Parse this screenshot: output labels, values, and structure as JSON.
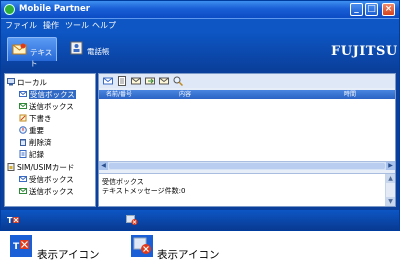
{
  "window": {
    "title": "Mobile Partner",
    "buttons": {
      "minimize": "_",
      "maximize": "□",
      "close": "×"
    }
  },
  "menu": [
    "ファイル",
    "操作",
    "ツール",
    "ヘルプ"
  ],
  "tabs": [
    {
      "label": "テキスト",
      "icon": "envelope-icon",
      "active": true
    },
    {
      "label": "電話帳",
      "icon": "phonebook-icon",
      "active": false
    }
  ],
  "brand": "FUJITSU",
  "tree": {
    "local": {
      "label": "ローカル",
      "items": [
        "受信ボックス",
        "送信ボックス",
        "下書き",
        "重要",
        "削除済",
        "記録"
      ],
      "selected": "受信ボックス"
    },
    "sim": {
      "label": "SIM/USIMカード",
      "items": [
        "受信ボックス",
        "送信ボックス"
      ]
    }
  },
  "toolbar_icons": [
    "new-message-icon",
    "new-document-icon",
    "reply-icon",
    "forward-icon",
    "save-icon",
    "search-icon"
  ],
  "list": {
    "columns": [
      "名前/番号",
      "内容",
      "時間"
    ]
  },
  "preview": {
    "line1": "受信ボックス",
    "line2": "テキストメッセージ件数:0"
  },
  "status_icons": [
    "display-icon-1",
    "display-icon-2"
  ],
  "legend": [
    {
      "icon": "display-icon-1",
      "label": "表示アイコン"
    },
    {
      "icon": "display-icon-2",
      "label": "表示アイコン"
    }
  ],
  "colors": {
    "titlebar": "#1a5fd6",
    "menubar": "#0d56c4",
    "selection": "#316ac5",
    "close_button": "#d4431e"
  }
}
